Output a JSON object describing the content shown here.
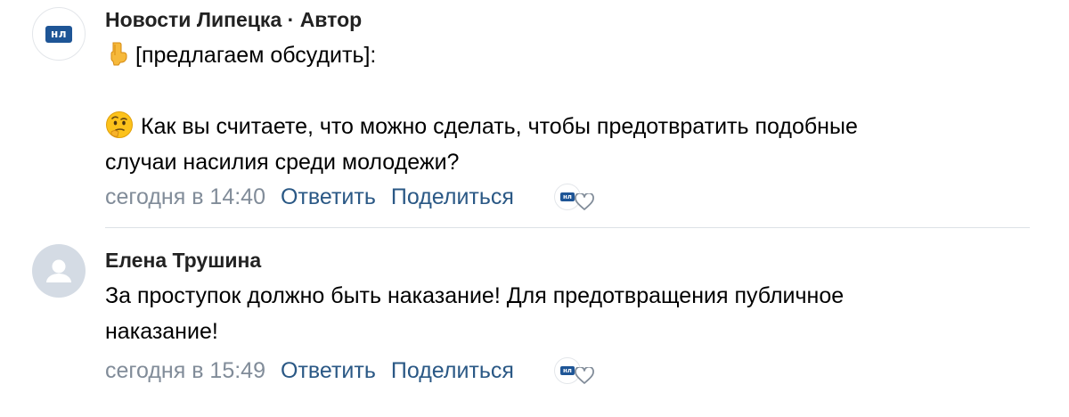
{
  "comments": [
    {
      "avatar_text": "нл",
      "author": "Новости Липецка",
      "author_separator": " · ",
      "author_role": "Автор",
      "lines": [
        "[предлагаем обсудить]:",
        "",
        "Как вы считаете, что можно сделать, чтобы предотвратить подобные",
        "случаи насилия среди молодежи?"
      ],
      "line_icons": [
        "point-down-emoji-icon",
        "",
        "thinking-emoji-icon",
        ""
      ],
      "time": "сегодня в 14:40",
      "reply_label": "Ответить",
      "share_label": "Поделиться",
      "liked_by_avatar_text": "нл"
    },
    {
      "author": "Елена Трушина",
      "lines": [
        "За проступок должно быть наказание! Для предотвращения публичное",
        "наказание!"
      ],
      "time": "сегодня в 15:49",
      "reply_label": "Ответить",
      "share_label": "Поделиться",
      "liked_by_avatar_text": "нл"
    }
  ],
  "colors": {
    "link": "#2a5885",
    "meta": "#818c99",
    "brand_badge": "#1e5596",
    "avatar_placeholder": "#d4dbe4",
    "divider": "#dce1e6"
  }
}
